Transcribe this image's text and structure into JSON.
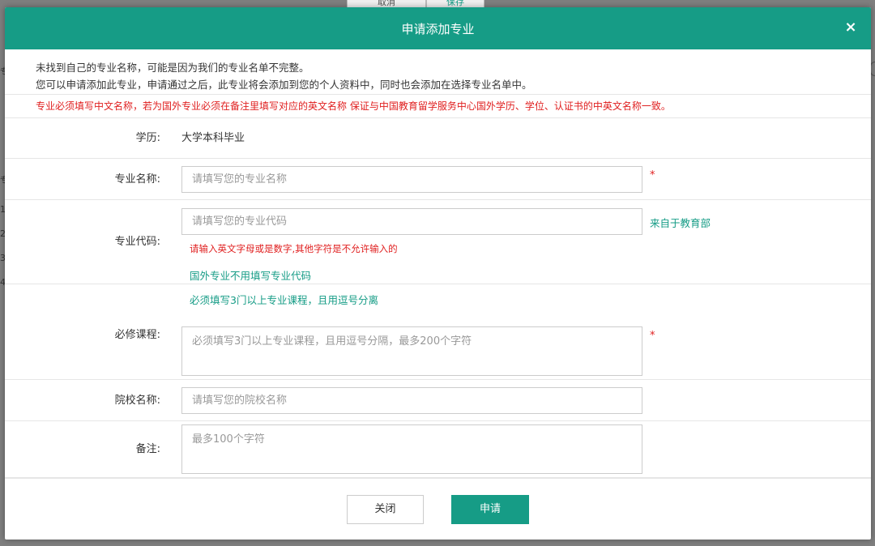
{
  "background": {
    "cancel_label": "取消",
    "save_label": "保存",
    "side_fragments": [
      "专",
      "专",
      "1",
      "2",
      "3",
      "4"
    ]
  },
  "dialog": {
    "title": "申请添加专业",
    "close_icon": "×",
    "intro_line1": "未找到自己的专业名称，可能是因为我们的专业名单不完整。",
    "intro_line2": "您可以申请添加此专业，申请通过之后，此专业将会添加到您的个人资料中，同时也会添加在选择专业名单中。",
    "warning": "专业必须填写中文名称，若为国外专业必须在备注里填写对应的英文名称 保证与中国教育留学服务中心国外学历、学位、认证书的中英文名称一致。"
  },
  "form": {
    "education": {
      "label": "学历:",
      "value": "大学本科毕业"
    },
    "major_name": {
      "label": "专业名称:",
      "placeholder": "请填写您的专业名称",
      "required_mark": "*"
    },
    "major_code": {
      "label": "专业代码:",
      "placeholder": "请填写您的专业代码",
      "source_note": "来自于教育部",
      "error_hint": "请输入英文字母或是数字,其他字符是不允许输入的",
      "foreign_hint": "国外专业不用填写专业代码"
    },
    "courses": {
      "label": "必修课程:",
      "top_hint": "必须填写3门以上专业课程，且用逗号分离",
      "placeholder": "必须填写3门以上专业课程，且用逗号分隔，最多200个字符",
      "required_mark": "*"
    },
    "school": {
      "label": "院校名称:",
      "placeholder": "请填写您的院校名称"
    },
    "remarks": {
      "label": "备注:",
      "placeholder": "最多100个字符"
    }
  },
  "footer": {
    "close_label": "关闭",
    "apply_label": "申请"
  },
  "colors": {
    "accent": "#169c86",
    "error": "#e02020",
    "overlay": "#7f7f7f"
  }
}
